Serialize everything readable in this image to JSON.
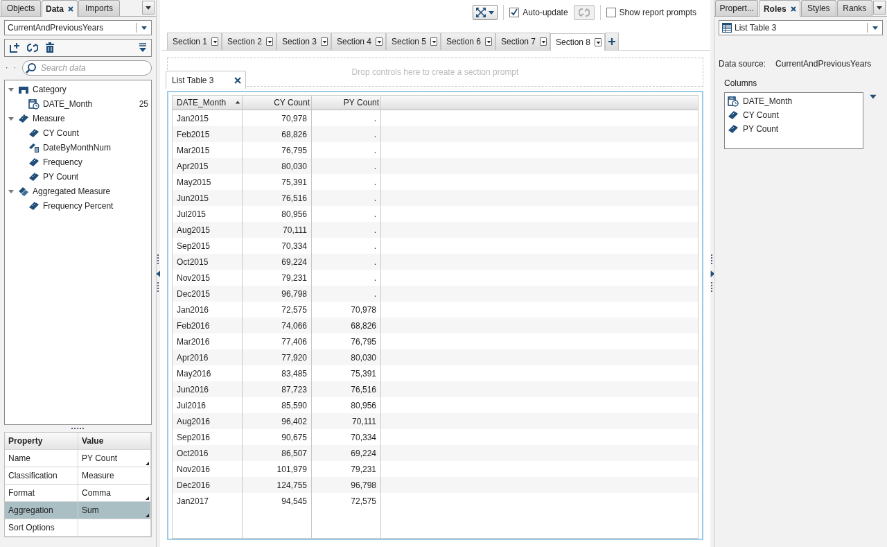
{
  "left_tabs": [
    {
      "label": "Objects",
      "selected": false,
      "closable": false
    },
    {
      "label": "Data",
      "selected": true,
      "closable": true
    },
    {
      "label": "Imports",
      "selected": false,
      "closable": false
    }
  ],
  "data_source": {
    "value": "CurrentAndPreviousYears"
  },
  "search": {
    "placeholder": "Search data"
  },
  "tree": [
    {
      "label": "Category",
      "kind": "category",
      "expanded": true,
      "children": [
        {
          "label": "DATE_Month",
          "kind": "date",
          "count": "25"
        }
      ]
    },
    {
      "label": "Measure",
      "kind": "measure",
      "expanded": true,
      "children": [
        {
          "label": "CY Count",
          "kind": "measure"
        },
        {
          "label": "DateByMonthNum",
          "kind": "calculated"
        },
        {
          "label": "Frequency",
          "kind": "measure"
        },
        {
          "label": "PY Count",
          "kind": "measure"
        }
      ]
    },
    {
      "label": "Aggregated Measure",
      "kind": "aggregated",
      "expanded": true,
      "children": [
        {
          "label": "Frequency Percent",
          "kind": "measure"
        }
      ]
    }
  ],
  "properties": {
    "columns": [
      "Property",
      "Value"
    ],
    "rows": [
      {
        "property": "Name",
        "value": "PY Count",
        "editable": true,
        "selected": false
      },
      {
        "property": "Classification",
        "value": "Measure",
        "editable": false,
        "selected": false
      },
      {
        "property": "Format",
        "value": "Comma",
        "editable": true,
        "selected": false
      },
      {
        "property": "Aggregation",
        "value": "Sum",
        "editable": true,
        "selected": true
      },
      {
        "property": "Sort Options",
        "value": "",
        "editable": false,
        "selected": false
      }
    ]
  },
  "toolbar": {
    "auto_update": {
      "label": "Auto-update",
      "checked": true
    },
    "show_prompts": {
      "label": "Show report prompts",
      "checked": false
    }
  },
  "sections": [
    {
      "label": "Section 1",
      "selected": false
    },
    {
      "label": "Section 2",
      "selected": false
    },
    {
      "label": "Section 3",
      "selected": false
    },
    {
      "label": "Section 4",
      "selected": false
    },
    {
      "label": "Section 5",
      "selected": false
    },
    {
      "label": "Section 6",
      "selected": false
    },
    {
      "label": "Section 7",
      "selected": false
    },
    {
      "label": "Section 8",
      "selected": true
    }
  ],
  "prompt_area": {
    "text": "Drop controls here to create a section prompt"
  },
  "object_tab": {
    "label": "List Table 3"
  },
  "table": {
    "columns": [
      "DATE_Month",
      "CY Count",
      "PY Count"
    ],
    "rows": [
      [
        "Jan2015",
        "70,978",
        "."
      ],
      [
        "Feb2015",
        "68,826",
        "."
      ],
      [
        "Mar2015",
        "76,795",
        "."
      ],
      [
        "Apr2015",
        "80,030",
        "."
      ],
      [
        "May2015",
        "75,391",
        "."
      ],
      [
        "Jun2015",
        "76,516",
        "."
      ],
      [
        "Jul2015",
        "80,956",
        "."
      ],
      [
        "Aug2015",
        "70,111",
        "."
      ],
      [
        "Sep2015",
        "70,334",
        "."
      ],
      [
        "Oct2015",
        "69,224",
        "."
      ],
      [
        "Nov2015",
        "79,231",
        "."
      ],
      [
        "Dec2015",
        "96,798",
        "."
      ],
      [
        "Jan2016",
        "72,575",
        "70,978"
      ],
      [
        "Feb2016",
        "74,066",
        "68,826"
      ],
      [
        "Mar2016",
        "77,406",
        "76,795"
      ],
      [
        "Apr2016",
        "77,920",
        "80,030"
      ],
      [
        "May2016",
        "83,485",
        "75,391"
      ],
      [
        "Jun2016",
        "87,723",
        "76,516"
      ],
      [
        "Jul2016",
        "85,590",
        "80,956"
      ],
      [
        "Aug2016",
        "96,402",
        "70,111"
      ],
      [
        "Sep2016",
        "90,675",
        "70,334"
      ],
      [
        "Oct2016",
        "86,507",
        "69,224"
      ],
      [
        "Nov2016",
        "101,979",
        "79,231"
      ],
      [
        "Dec2016",
        "124,755",
        "96,798"
      ],
      [
        "Jan2017",
        "94,545",
        "72,575"
      ]
    ]
  },
  "right_tabs": [
    {
      "label": "Propert...",
      "selected": false,
      "closable": false
    },
    {
      "label": "Roles",
      "selected": true,
      "closable": true
    },
    {
      "label": "Styles",
      "selected": false,
      "closable": false
    },
    {
      "label": "Ranks",
      "selected": false,
      "closable": false
    }
  ],
  "object_select": {
    "value": "List Table 3"
  },
  "roles": {
    "data_source_label": "Data source:",
    "data_source": "CurrentAndPreviousYears",
    "columns_label": "Columns",
    "columns": [
      {
        "label": "DATE_Month",
        "kind": "date"
      },
      {
        "label": "CY Count",
        "kind": "measure"
      },
      {
        "label": "PY Count",
        "kind": "measure"
      }
    ]
  }
}
